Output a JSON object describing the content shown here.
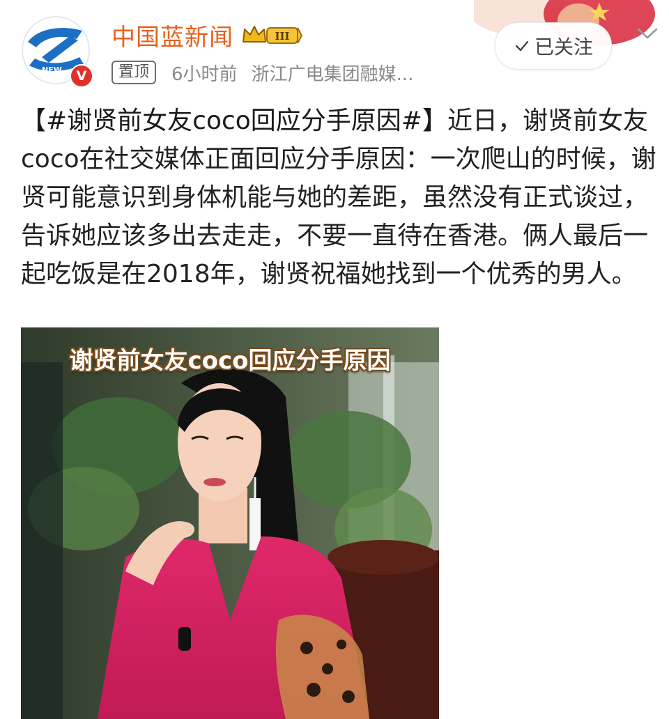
{
  "account": {
    "name": "中国蓝新闻",
    "level_badge": "III",
    "avatar_mark": "V",
    "avatar_logo_text": "NEW"
  },
  "meta": {
    "pin_label": "置顶",
    "time": "6小时前",
    "source": "浙江广电集团融媒..."
  },
  "actions": {
    "follow_label": "已关注"
  },
  "post": {
    "topic": "【#谢贤前女友coco回应分手原因#】",
    "body": "近日，谢贤前女友coco在社交媒体正面回应分手原因：一次爬山的时候，谢贤可能意识到身体机能与她的差距，虽然没有正式谈过，告诉她应该多出去走走，不要一直待在香港。俩人最后一起吃饭是在2018年，谢贤祝福她找到一个优秀的男人。"
  },
  "media": {
    "caption": "谢贤前女友coco回应分手原因"
  },
  "colors": {
    "brand_orange": "#e8601c",
    "avatar_blue": "#1d6fc4",
    "verified_red": "#e0302d",
    "dress_pink": "#d21e5e"
  }
}
